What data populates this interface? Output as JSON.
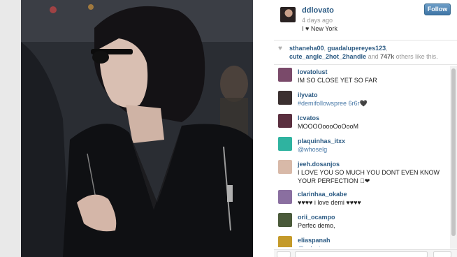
{
  "post": {
    "username": "ddlovato",
    "posted": "4 days ago",
    "location": "I ♥ New York",
    "follow_label": "Follow"
  },
  "likes": {
    "user1": "sthaneha00",
    "user2": "guadalupereyes123",
    "user3": "cute_angle_2hot_2handle",
    "and": "and",
    "count": "747k",
    "suffix": "others like this."
  },
  "comments": [
    {
      "user": "lovatolust",
      "text": "IM SO CLOSE YET SO FAR",
      "avatar_color": "#7a4a6a",
      "link": false
    },
    {
      "user": "ilyvato",
      "text": "#demifollowspree 6r6r🖤",
      "avatar_color": "#3b3030",
      "link": true
    },
    {
      "user": "lcvatos",
      "text": "MOOOOoooOoOooM",
      "avatar_color": "#5a2f3f",
      "link": false
    },
    {
      "user": "plaquinhas_itxx",
      "text": "@whoselg",
      "avatar_color": "#2fb3a0",
      "link": true
    },
    {
      "user": "jeeh.dosanjos",
      "text": "I LOVE YOU SO MUCH YOU DONT EVEN KNOW YOUR PERFECTION 🏻❤",
      "avatar_color": "#d8b9a8",
      "link": false
    },
    {
      "user": "clarinhaa_okabe",
      "text": "♥♥♥♥ i love demi ♥♥♥♥",
      "avatar_color": "#8a6fa0",
      "link": false
    },
    {
      "user": "orii_ocampo",
      "text": "Perfec demo,",
      "avatar_color": "#4a5a3a",
      "link": false
    },
    {
      "user": "eliaspanah",
      "text": "@salgai",
      "avatar_color": "#c49a2a",
      "link": true
    }
  ],
  "icons": {
    "heart": "heart-icon",
    "follow": "follow-button"
  },
  "colors": {
    "username_blue": "#2b5a83",
    "follow_blue": "#3f75a6",
    "link_blue": "#4a7aa8"
  }
}
